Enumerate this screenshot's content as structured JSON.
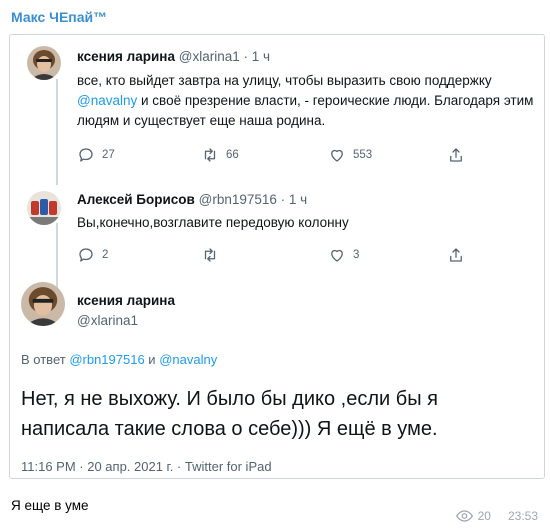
{
  "channel": {
    "name": "Макс ЧЕпай™"
  },
  "tweets": [
    {
      "author": "ксения ларина",
      "handle": "@xlarina1",
      "meta": "· 1 ч",
      "text": {
        "p1": "все, кто выйдет завтра на улицу, чтобы выразить свою поддержку ",
        "mention": "@navalny",
        "p2": " и своё презрение власти, - героические люди. Благодаря этим людям и существует еще наша родина."
      },
      "stats": {
        "replies": "27",
        "retweets": "66",
        "likes": "553"
      }
    },
    {
      "author": "Алексей Борисов",
      "handle": "@rbn197516",
      "meta": "· 1 ч",
      "text": "Вы,конечно,возглавите передовую колонну",
      "stats": {
        "replies": "2",
        "retweets": "",
        "likes": "3"
      }
    }
  ],
  "main_tweet": {
    "author": "ксения ларина",
    "handle": "@xlarina1",
    "reply_prefix": "В ответ ",
    "reply_mention1": "@rbn197516",
    "reply_and": " и ",
    "reply_mention2": "@navalny",
    "text": "Нет, я не выхожу. И было бы дико ,если бы я написала такие слова о себе))) Я ещё в уме.",
    "meta": "11:16 PM · 20 апр. 2021 г. · Twitter for iPad"
  },
  "message": {
    "caption": "Я еще в уме",
    "views": "20",
    "time": "23:53"
  },
  "icons": {
    "reply": "reply-icon",
    "retweet": "retweet-icon",
    "like": "heart-icon",
    "share": "share-icon",
    "views": "eye-icon"
  },
  "colors": {
    "accent": "#3a8fd0",
    "mention": "#1d9bf0",
    "muted": "#536471"
  }
}
